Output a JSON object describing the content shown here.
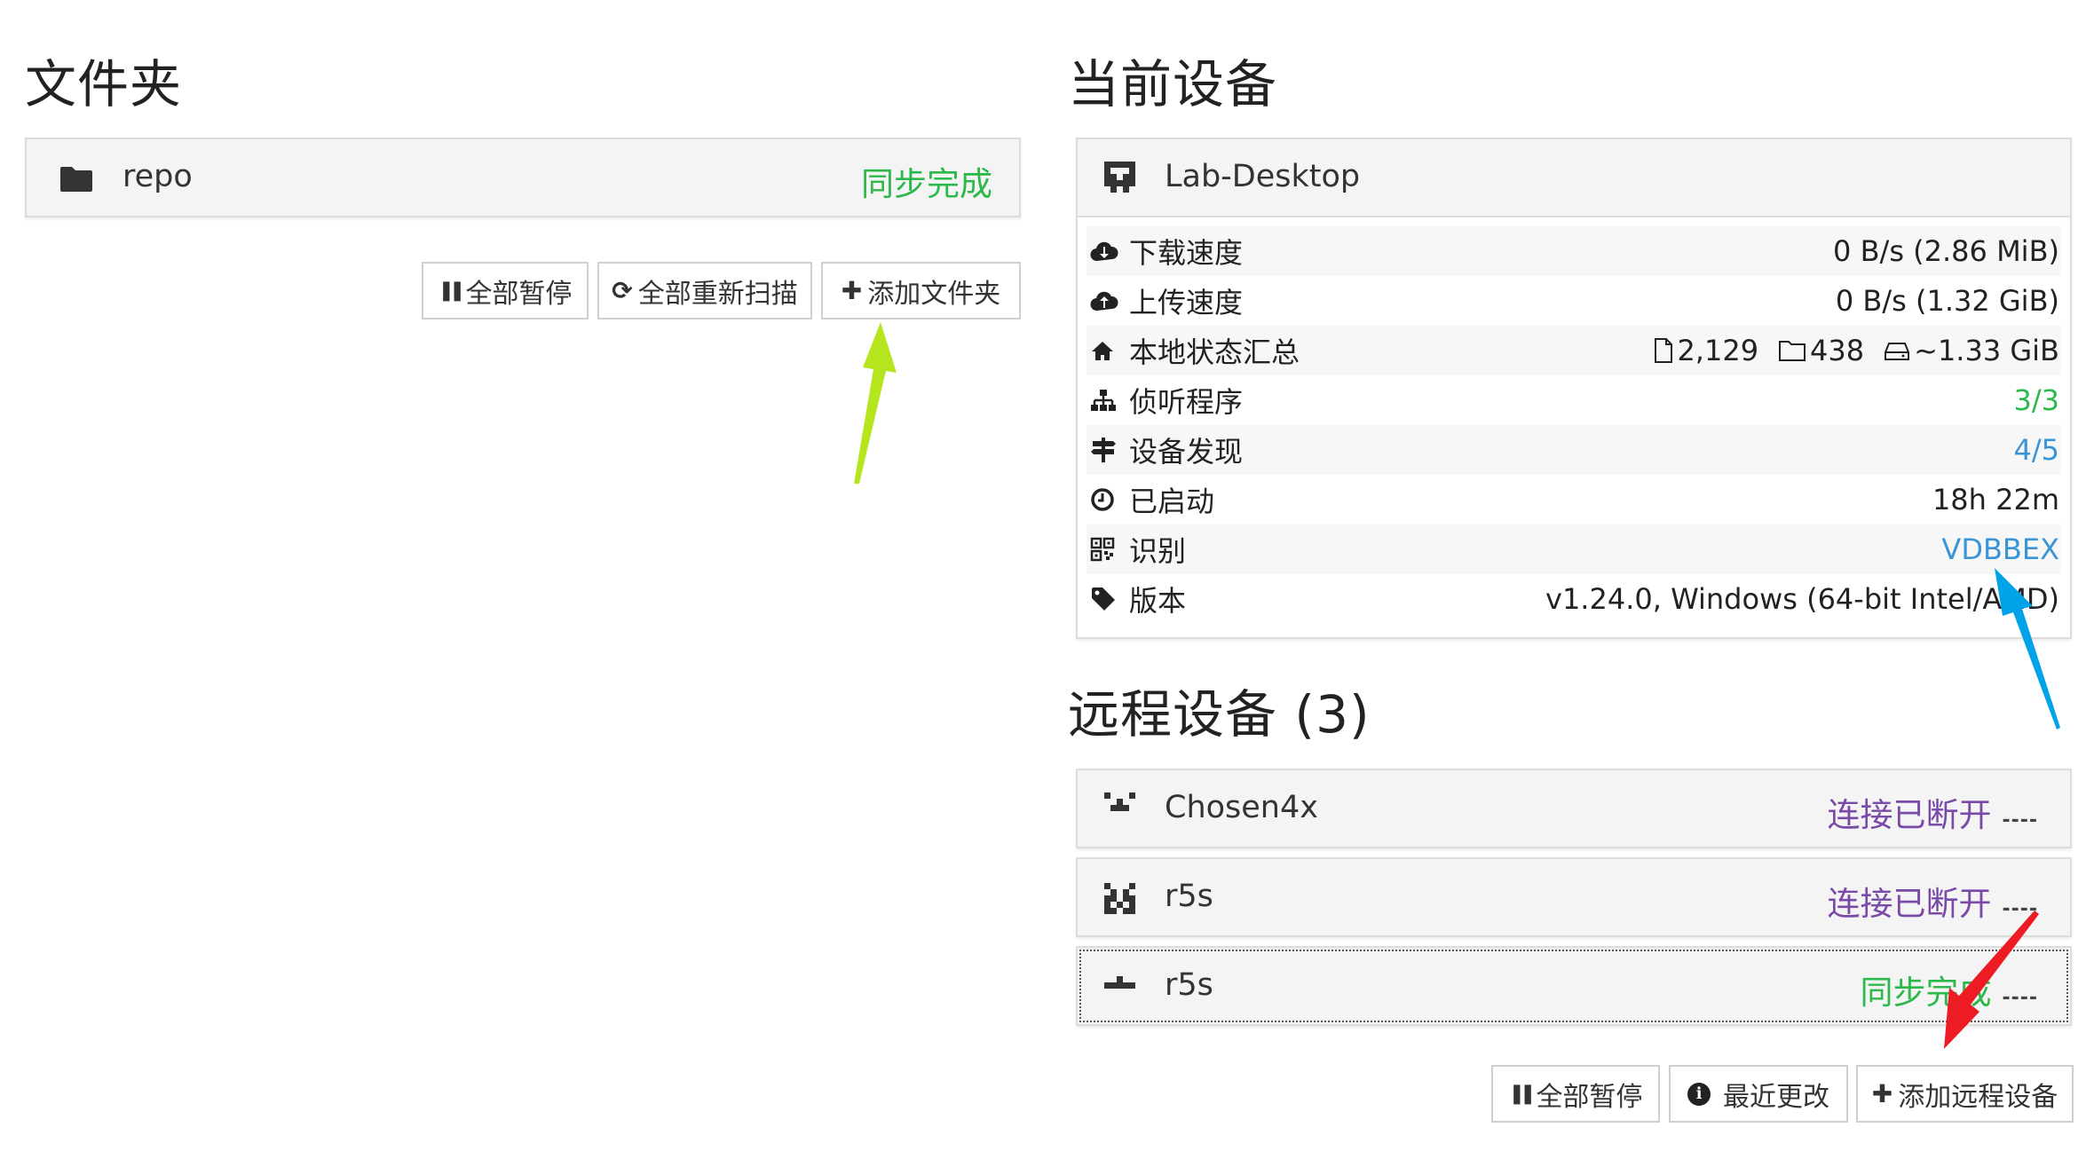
{
  "folders": {
    "title": "文件夹",
    "items": [
      {
        "name": "repo",
        "status": "同步完成",
        "status_color": "#2cb84a",
        "icon": "folder-icon"
      }
    ],
    "buttons": [
      {
        "label": "全部暂停",
        "icon": "pause-icon",
        "glyph": "❚❚"
      },
      {
        "label": "全部重新扫描",
        "icon": "refresh-icon",
        "glyph": "⟳"
      },
      {
        "label": "添加文件夹",
        "icon": "plus-icon",
        "glyph": "✚"
      }
    ]
  },
  "this_device": {
    "title": "当前设备",
    "name": "Lab-Desktop",
    "rows": [
      {
        "label": "下载速度",
        "icon": "cloud-download-icon",
        "value": "0 B/s (2.86 MiB)"
      },
      {
        "label": "上传速度",
        "icon": "cloud-upload-icon",
        "value": "0 B/s (1.32 GiB)"
      },
      {
        "label": "本地状态汇总",
        "icon": "home-icon",
        "files": "2,129",
        "dirs": "438",
        "size": "~1.33 GiB"
      },
      {
        "label": "侦听程序",
        "icon": "sitemap-icon",
        "value": "3/3",
        "color": "#2cb84a"
      },
      {
        "label": "设备发现",
        "icon": "signpost-icon",
        "value": "4/5",
        "color": "#3a94d6"
      },
      {
        "label": "已启动",
        "icon": "clock-icon",
        "value": "18h 22m"
      },
      {
        "label": "识别",
        "icon": "qrcode-icon",
        "value": "VDBBEX",
        "color": "#3a94d6"
      },
      {
        "label": "版本",
        "icon": "tag-icon",
        "value": "v1.24.0, Windows (64-bit Intel/AMD)"
      }
    ]
  },
  "remote_devices": {
    "title": "远程设备 (3)",
    "items": [
      {
        "name": "Chosen4x",
        "status": "连接已断开",
        "status_color": "#7a4aa8",
        "extra": "----"
      },
      {
        "name": "r5s",
        "status": "连接已断开",
        "status_color": "#7a4aa8",
        "extra": "----"
      },
      {
        "name": "r5s",
        "status": "同步完成",
        "status_color": "#2cb84a",
        "extra": "----"
      }
    ],
    "buttons": [
      {
        "label": "全部暂停",
        "icon": "pause-icon",
        "glyph": "❚❚"
      },
      {
        "label": "最近更改",
        "icon": "info-circle-icon",
        "glyph": "ℹ"
      },
      {
        "label": "添加远程设备",
        "icon": "plus-icon",
        "glyph": "✚"
      }
    ]
  },
  "annotations": {
    "green_arrow_color": "#b5e61d",
    "blue_arrow_color": "#00a2e8",
    "red_arrow_color": "#ed1c24"
  }
}
